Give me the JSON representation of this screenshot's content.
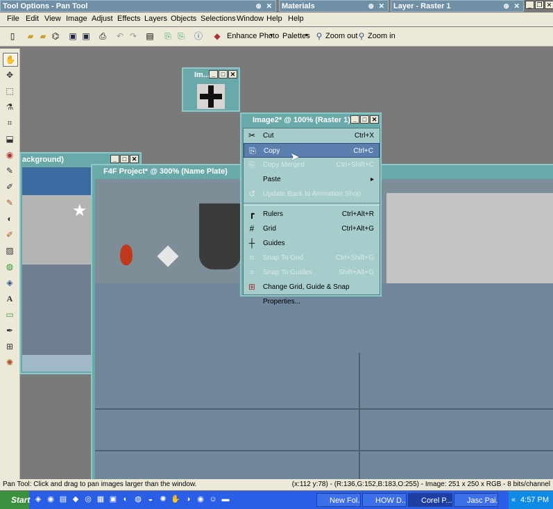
{
  "palettes": {
    "tool_options": "Tool Options - Pan Tool",
    "materials": "Materials",
    "layer": "Layer - Raster 1"
  },
  "menubar": [
    "File",
    "Edit",
    "View",
    "Image",
    "Adjust",
    "Effects",
    "Layers",
    "Objects",
    "Selections",
    "Window",
    "Help",
    "Help"
  ],
  "toolbar": {
    "enhance_photo": "Enhance Photo",
    "palettes": "Palettes",
    "zoom_out": "Zoom out",
    "zoom_in": "Zoom in"
  },
  "windows": {
    "small_image": "Im...",
    "background": "ackground)",
    "f4f": "F4F Project* @ 300% (Name Plate)",
    "image2": "Image2* @ 100% (Raster 1)"
  },
  "context_menu": {
    "items": [
      {
        "label": "Cut",
        "shortcut": "Ctrl+X",
        "icon": "✂"
      },
      {
        "label": "Copy",
        "shortcut": "Ctrl+C",
        "icon": "⎘"
      },
      {
        "label": "Copy Merged",
        "shortcut": "Ctrl+Shift+C",
        "icon": "⎘"
      },
      {
        "label": "Paste",
        "shortcut": "",
        "icon": ""
      },
      {
        "label": "Update Back to Animation Shop",
        "shortcut": "",
        "icon": "↺"
      },
      {
        "label": "Rulers",
        "shortcut": "Ctrl+Alt+R",
        "icon": "┏"
      },
      {
        "label": "Grid",
        "shortcut": "Ctrl+Alt+G",
        "icon": "#"
      },
      {
        "label": "Guides",
        "shortcut": "",
        "icon": "┼"
      },
      {
        "label": "Snap To Grid",
        "shortcut": "Ctrl+Shift+G",
        "icon": "⌗"
      },
      {
        "label": "Snap To Guides",
        "shortcut": "Shift+Alt+G",
        "icon": "⌗"
      },
      {
        "label": "Change Grid, Guide & Snap Properties...",
        "shortcut": "",
        "icon": "⊞"
      }
    ]
  },
  "status": {
    "left": "Pan Tool: Click and drag to pan images larger than the window.",
    "right": "(x:112 y:78) - (R:136,G:152,B:183,O:255) - Image:  251 x 250 x RGB - 8 bits/channel"
  },
  "taskbar": {
    "start": "Start",
    "tasks": [
      "New Fol...",
      "HOW D...",
      "Corel P...",
      "Jasc Pai..."
    ],
    "time": "4:57 PM"
  }
}
